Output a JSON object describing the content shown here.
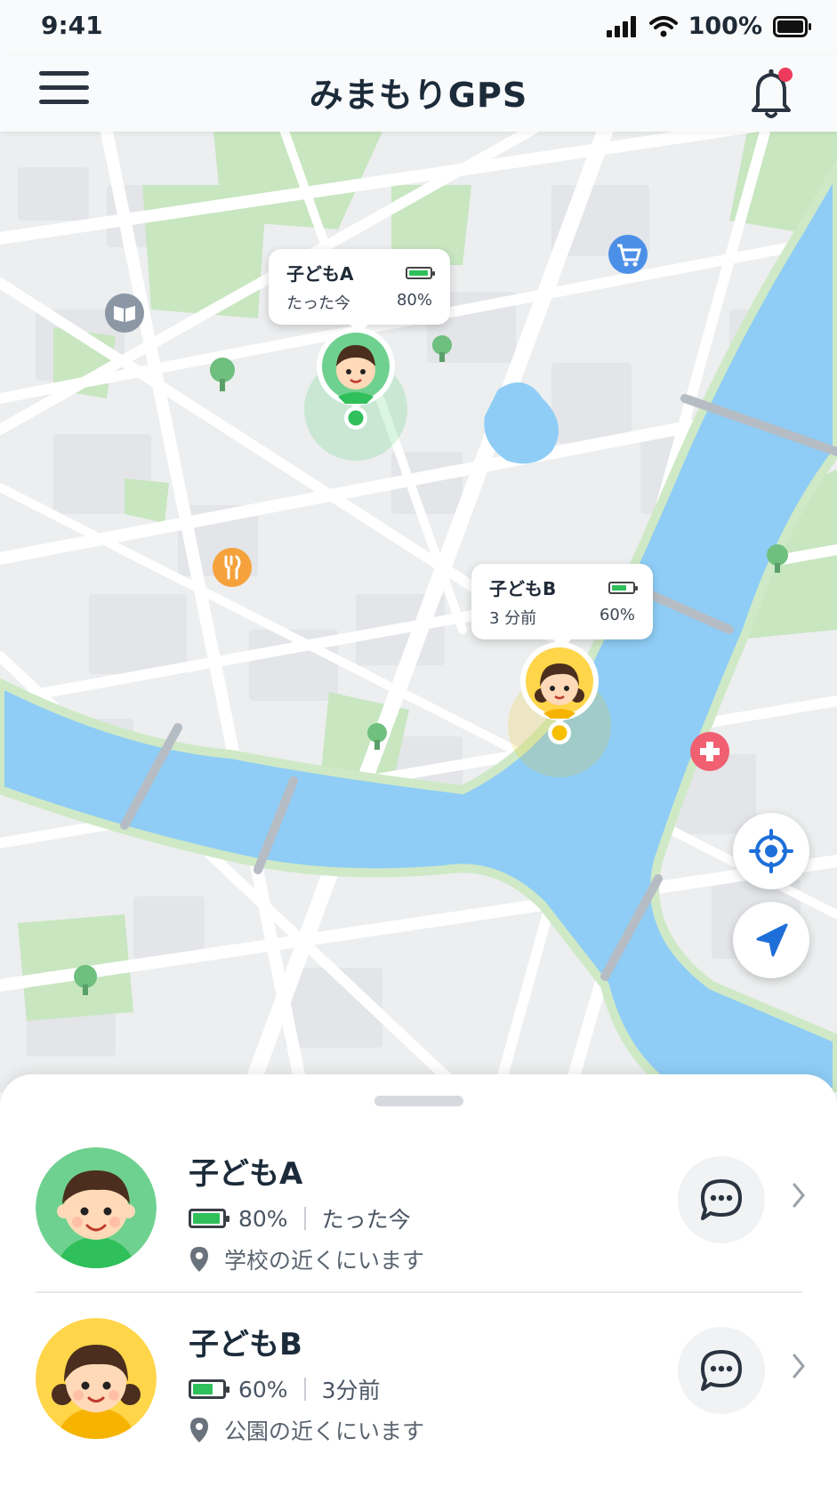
{
  "status_bar": {
    "time": "9:41",
    "battery": "100%"
  },
  "header": {
    "title": "みまもりGPS",
    "has_notification": true
  },
  "map": {
    "markers": [
      {
        "name": "子どもA",
        "time": "たった今",
        "battery": "80%",
        "battery_level": 0.8,
        "color": "#34c759"
      },
      {
        "name": "子どもB",
        "time": "3 分前",
        "battery": "60%",
        "battery_level": 0.6,
        "color": "#f6c000"
      }
    ]
  },
  "children": [
    {
      "name": "子どもA",
      "battery": "80%",
      "battery_level": 0.8,
      "updated": "たった今",
      "location": "学校の近くにいます",
      "avatar_color": "#6fd18f"
    },
    {
      "name": "子どもB",
      "battery": "60%",
      "battery_level": 0.6,
      "updated": "3分前",
      "location": "公園の近くにいます",
      "avatar_color": "#ffd54a"
    }
  ],
  "colors": {
    "water": "#8fcdf6",
    "park": "#c8e6c0",
    "accent": "#1e6fd9",
    "notification": "#ef3b5b"
  }
}
